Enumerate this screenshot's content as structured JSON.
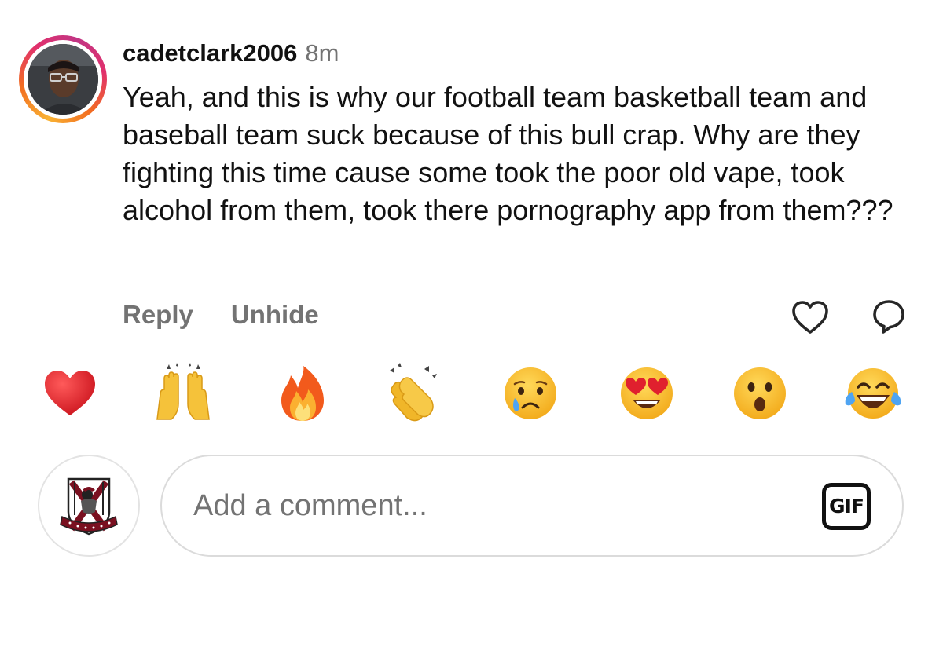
{
  "comment": {
    "username": "cadetclark2006",
    "timestamp": "8m",
    "text": "Yeah, and this is why our football team basketball team and baseball team suck because of this bull crap. Why are they fighting this time cause some took the poor old vape, took alcohol from them, took there pornography app from them???",
    "actions": {
      "reply_label": "Reply",
      "unhide_label": "Unhide"
    },
    "icons": {
      "like": "heart-outline-icon",
      "reply": "speech-bubble-icon"
    }
  },
  "reactions": [
    {
      "name": "red-heart",
      "glyph": "❤️"
    },
    {
      "name": "raising-hands",
      "glyph": "🙌"
    },
    {
      "name": "fire",
      "glyph": "🔥"
    },
    {
      "name": "clapping-hands",
      "glyph": "👏"
    },
    {
      "name": "crying-face",
      "glyph": "😢"
    },
    {
      "name": "heart-eyes",
      "glyph": "😍"
    },
    {
      "name": "surprised-face",
      "glyph": "😮"
    },
    {
      "name": "tears-of-joy",
      "glyph": "😂"
    }
  ],
  "composer": {
    "placeholder": "Add a comment...",
    "gif_label": "GIF"
  },
  "colors": {
    "text": "#111111",
    "muted": "#737373",
    "divider": "#e6e6e6",
    "input_border": "#dbdbdb",
    "story_ring": [
      "#f9b233",
      "#f26d21",
      "#e1306c",
      "#c13584"
    ]
  }
}
